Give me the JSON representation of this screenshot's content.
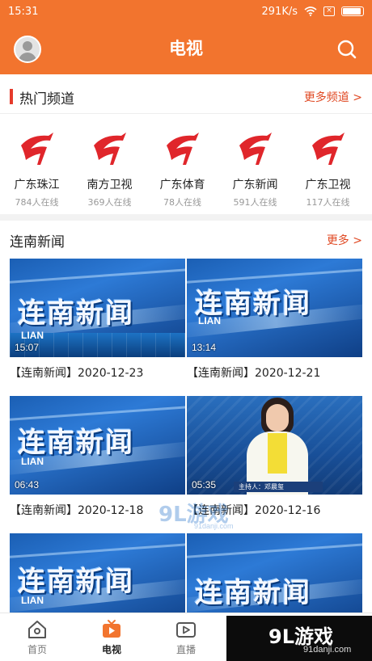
{
  "status_bar": {
    "time": "15:31",
    "network_speed": "291K/s",
    "wifi_icon": "wifi-icon",
    "sim_icon": "sim-x-icon",
    "battery_level": 0.9
  },
  "app_bar": {
    "title": "电视",
    "avatar_icon": "user-avatar-icon",
    "search_icon": "search-icon",
    "accent_color": "#f2742e"
  },
  "hot_channels": {
    "title": "热门频道",
    "more_label": "更多频道 >",
    "items": [
      {
        "name": "广东珠江",
        "viewers": "784人在线",
        "logo_icon": "gdtv-logo-icon"
      },
      {
        "name": "南方卫视",
        "viewers": "369人在线",
        "logo_icon": "gdtv-logo-icon"
      },
      {
        "name": "广东体育",
        "viewers": "78人在线",
        "logo_icon": "gdtv-logo-icon"
      },
      {
        "name": "广东新闻",
        "viewers": "591人在线",
        "logo_icon": "gdtv-logo-icon"
      },
      {
        "name": "广东卫视",
        "viewers": "117人在线",
        "logo_icon": "gdtv-logo-icon"
      }
    ]
  },
  "news_section": {
    "title": "连南新闻",
    "more_label": "更多 >",
    "videos": [
      {
        "thumb_text": "连南新闻",
        "thumb_sub": "LIAN",
        "duration": "15:07",
        "title": "【连南新闻】2020-12-23"
      },
      {
        "thumb_text": "连南新闻",
        "thumb_sub": "LIAN",
        "duration": "13:14",
        "title": "【连南新闻】2020-12-21"
      },
      {
        "thumb_text": "连南新闻",
        "thumb_sub": "LIAN",
        "duration": "06:43",
        "title": "【连南新闻】2020-12-18"
      },
      {
        "thumb_text": "主持人：邓晨玺",
        "duration": "05:35",
        "title": "【连南新闻】2020-12-16"
      },
      {
        "thumb_text": "连南新闻",
        "thumb_sub": "LIAN"
      },
      {
        "thumb_text": "连南新闻"
      }
    ]
  },
  "tab_bar": {
    "tabs": [
      {
        "label": "首页",
        "icon": "home-icon",
        "active": false
      },
      {
        "label": "电视",
        "icon": "tv-icon",
        "active": true
      },
      {
        "label": "直播",
        "icon": "live-video-icon",
        "active": false
      }
    ]
  },
  "watermark": {
    "main": "9L游戏",
    "sub": "91danji.com"
  },
  "colors": {
    "brand_orange": "#f2742e",
    "link_red": "#e04a24",
    "section_bar_red": "#e53b2c",
    "gdtv_red": "#e0262b"
  }
}
